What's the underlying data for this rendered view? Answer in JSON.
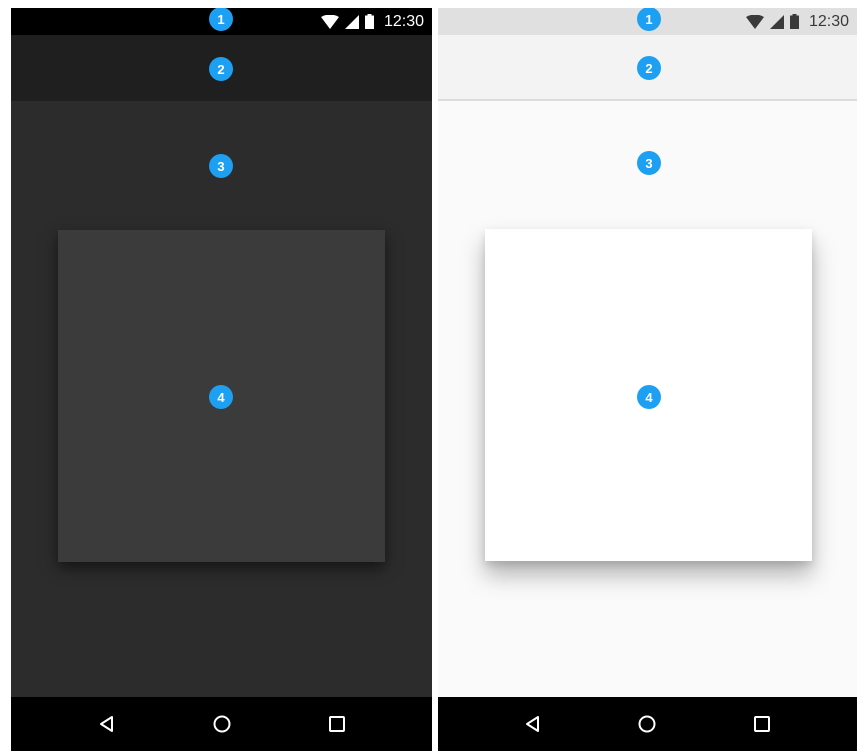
{
  "colors": {
    "marker": "#1ea0f2",
    "dark_background": "#2c2c2c",
    "dark_card": "#3b3b3b",
    "light_background": "#fafafa",
    "light_card": "#ffffff",
    "navigation_bar": "#000000"
  },
  "status_bar": {
    "time": "12:30",
    "icons": [
      "wifi-icon",
      "signal-icon",
      "battery-icon"
    ]
  },
  "navigation_bar": {
    "buttons": [
      "back-icon",
      "home-icon",
      "recents-icon"
    ]
  },
  "markers": {
    "status_bar": "1",
    "app_bar": "2",
    "background": "3",
    "card": "4"
  }
}
